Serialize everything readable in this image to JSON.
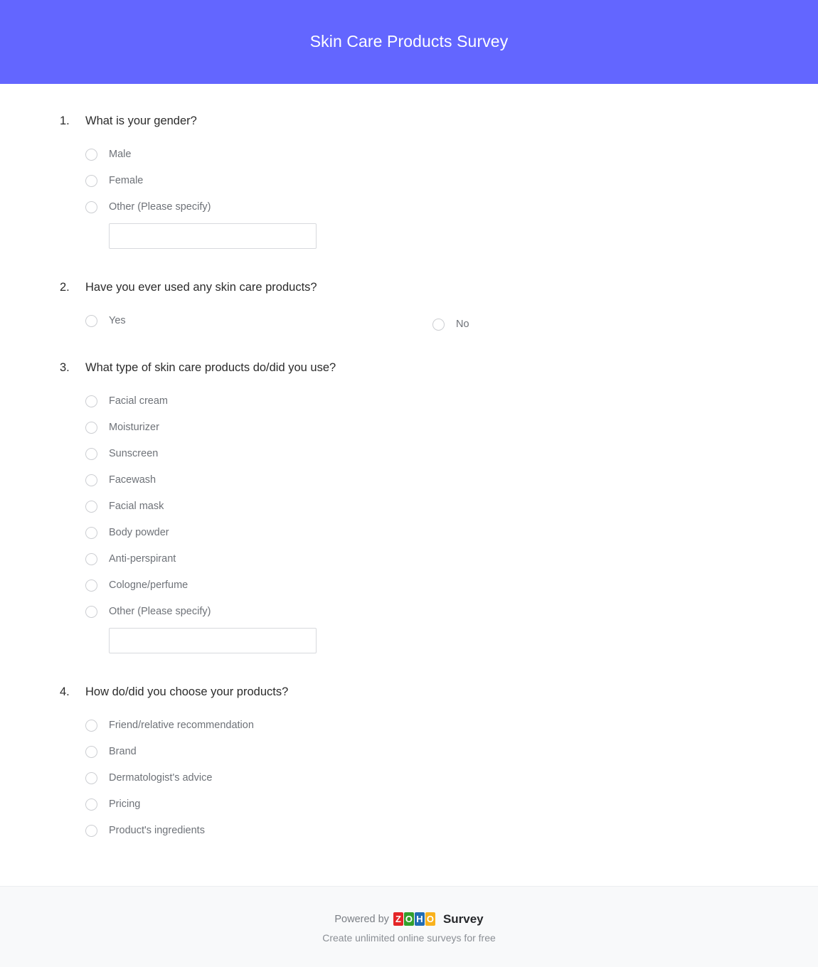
{
  "header": {
    "title": "Skin Care Products Survey",
    "background_color": "#6366ff",
    "title_color": "#ffffff"
  },
  "questions": [
    {
      "number": "1.",
      "text": "What is your gender?",
      "layout": "single-column",
      "options": [
        {
          "label": "Male",
          "has_text_input": false
        },
        {
          "label": "Female",
          "has_text_input": false
        },
        {
          "label": "Other (Please specify)",
          "has_text_input": true,
          "input_value": "",
          "input_placeholder": ""
        }
      ]
    },
    {
      "number": "2.",
      "text": "Have you ever used any skin care products?",
      "layout": "two-column",
      "options": [
        {
          "label": "Yes",
          "has_text_input": false
        },
        {
          "label": "No",
          "has_text_input": false
        }
      ]
    },
    {
      "number": "3.",
      "text": "What type of skin care products do/did you use?",
      "layout": "single-column",
      "options": [
        {
          "label": "Facial cream",
          "has_text_input": false
        },
        {
          "label": "Moisturizer",
          "has_text_input": false
        },
        {
          "label": "Sunscreen",
          "has_text_input": false
        },
        {
          "label": "Facewash",
          "has_text_input": false
        },
        {
          "label": "Facial mask",
          "has_text_input": false
        },
        {
          "label": "Body powder",
          "has_text_input": false
        },
        {
          "label": "Anti-perspirant",
          "has_text_input": false
        },
        {
          "label": "Cologne/perfume",
          "has_text_input": false
        },
        {
          "label": "Other (Please specify)",
          "has_text_input": true,
          "input_value": "",
          "input_placeholder": ""
        }
      ]
    },
    {
      "number": "4.",
      "text": "How do/did you choose your products?",
      "layout": "single-column",
      "options": [
        {
          "label": "Friend/relative recommendation",
          "has_text_input": false
        },
        {
          "label": "Brand",
          "has_text_input": false
        },
        {
          "label": "Dermatologist's advice",
          "has_text_input": false
        },
        {
          "label": "Pricing",
          "has_text_input": false
        },
        {
          "label": "Product's ingredients",
          "has_text_input": false
        }
      ]
    }
  ],
  "footer": {
    "powered_by": "Powered by",
    "brand_letters": [
      "Z",
      "O",
      "H",
      "O"
    ],
    "brand_colors": [
      "#e42527",
      "#33a02c",
      "#226db4",
      "#f9b21d"
    ],
    "product_word": "Survey",
    "tagline": "Create unlimited online surveys for free"
  }
}
